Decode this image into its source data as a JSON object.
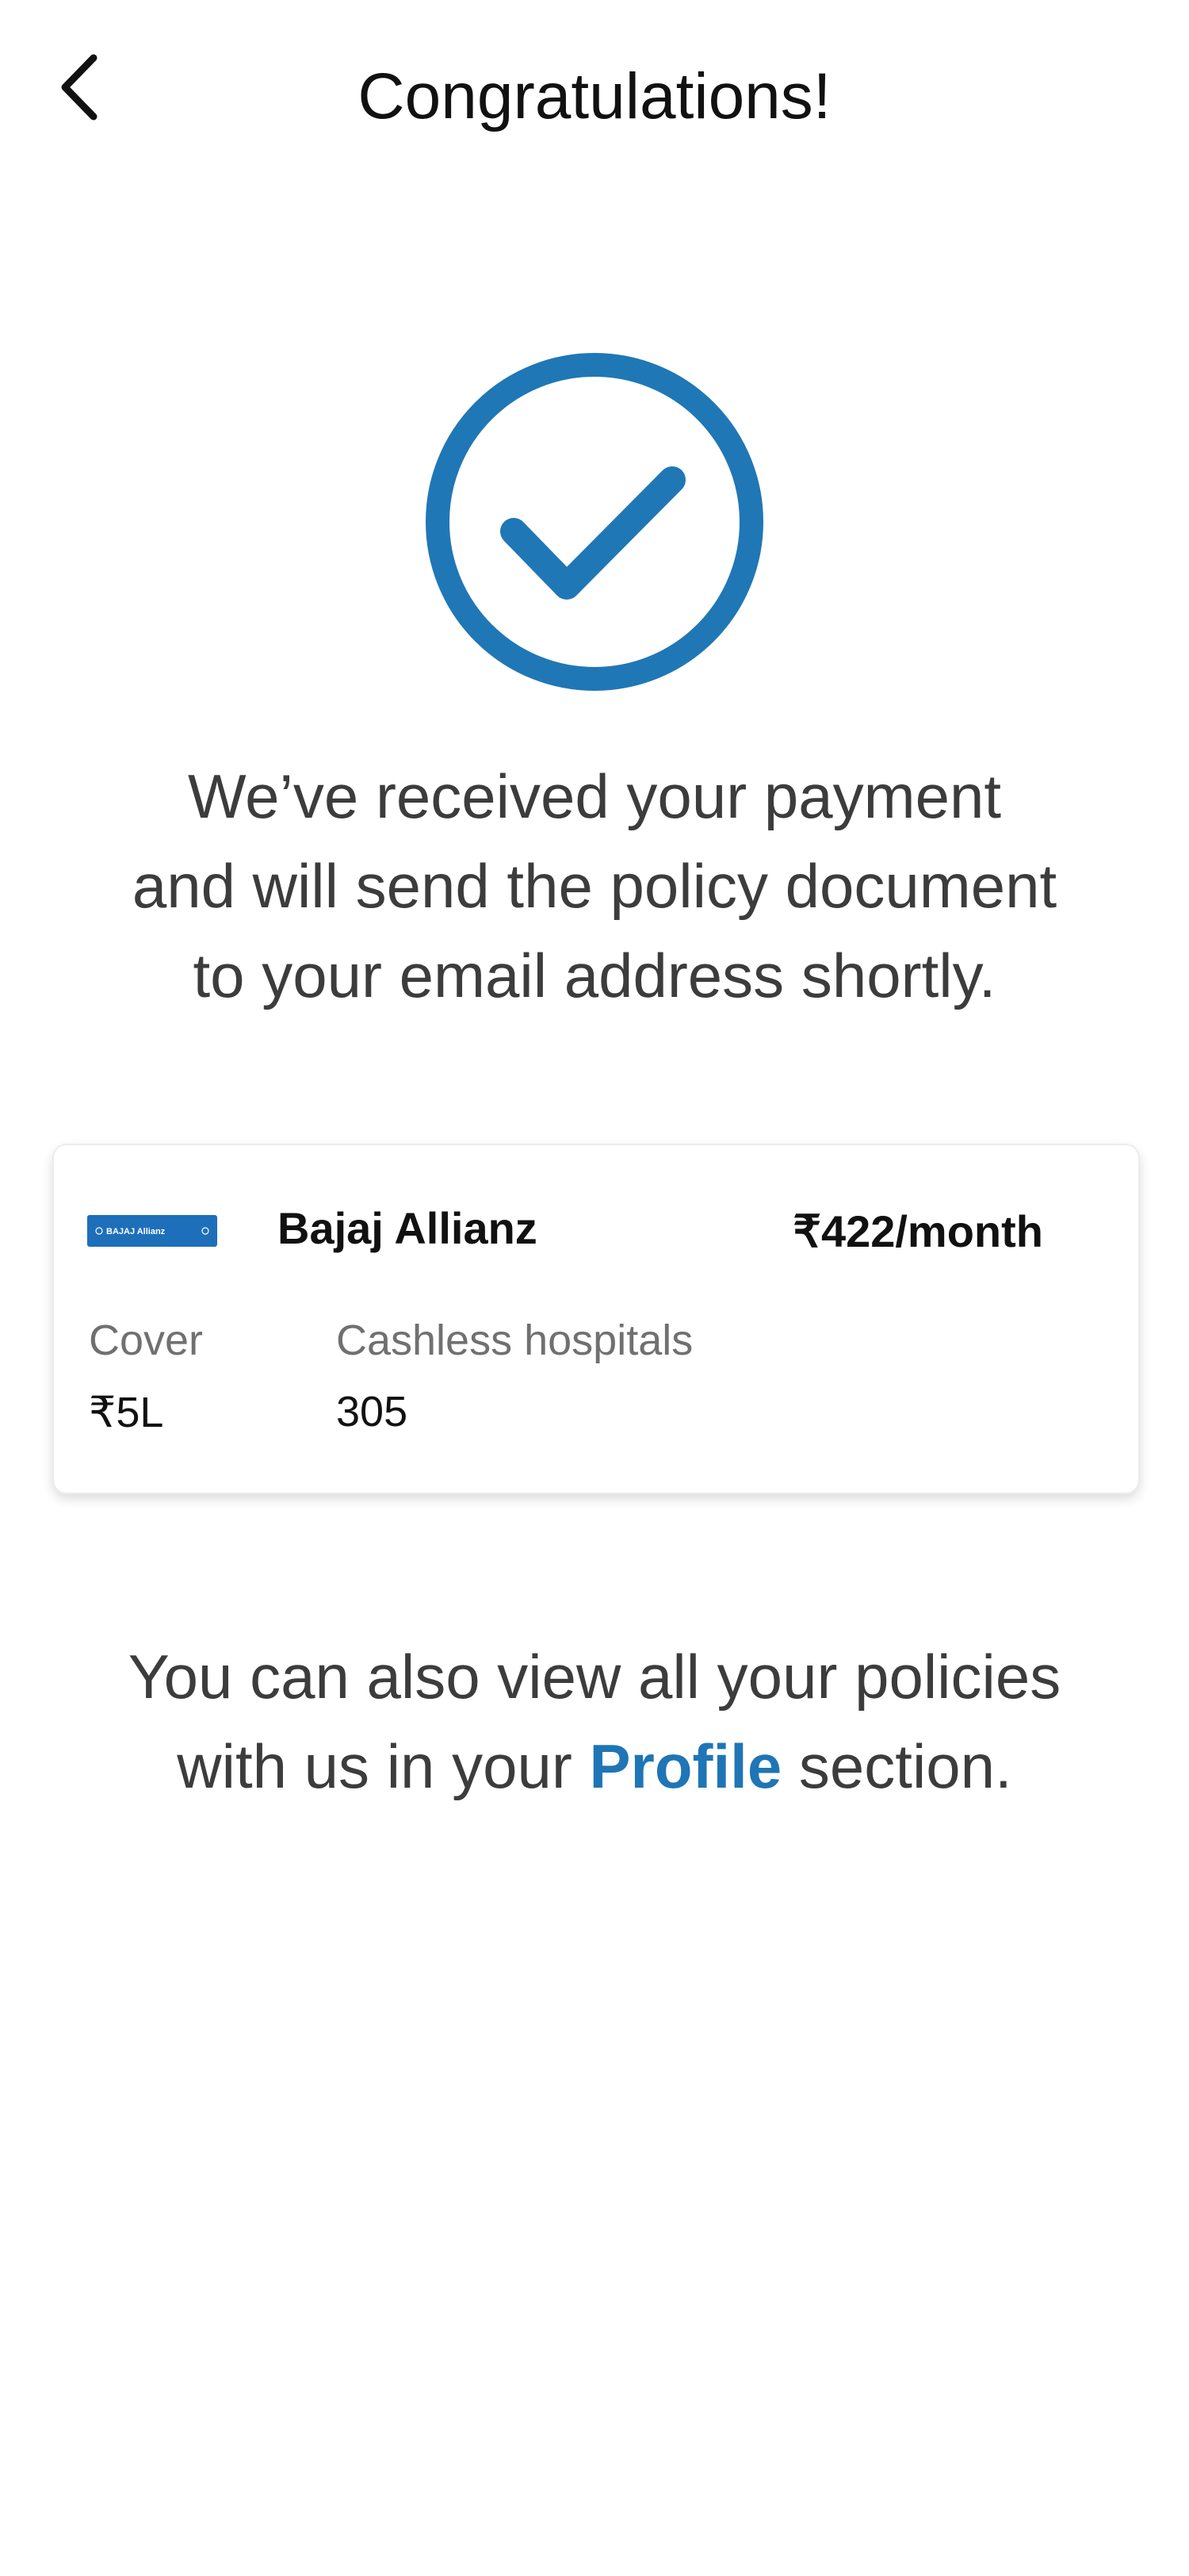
{
  "header": {
    "title": "Congratulations!",
    "back_icon": "chevron-left-icon"
  },
  "success": {
    "icon": "check-circle-icon",
    "color": "#2077b5"
  },
  "message": {
    "lines": [
      "We’ve received your payment",
      "and will send the policy document",
      "to your email address shortly."
    ]
  },
  "policy_card": {
    "logo_icon": "bajaj-allianz-logo",
    "logo_text": "BAJAJ Allianz",
    "insurer_name": "Bajaj Allianz",
    "premium": "₹422/month",
    "cover_label": "Cover",
    "cover_value": "₹5L",
    "hospitals_label": "Cashless hospitals",
    "hospitals_value": "305"
  },
  "footer_note": {
    "line1": "You can also view all your policies",
    "line2_prefix": "with us in your ",
    "profile_link": "Profile",
    "line2_suffix": " section.",
    "link_color": "#1f75b5"
  }
}
